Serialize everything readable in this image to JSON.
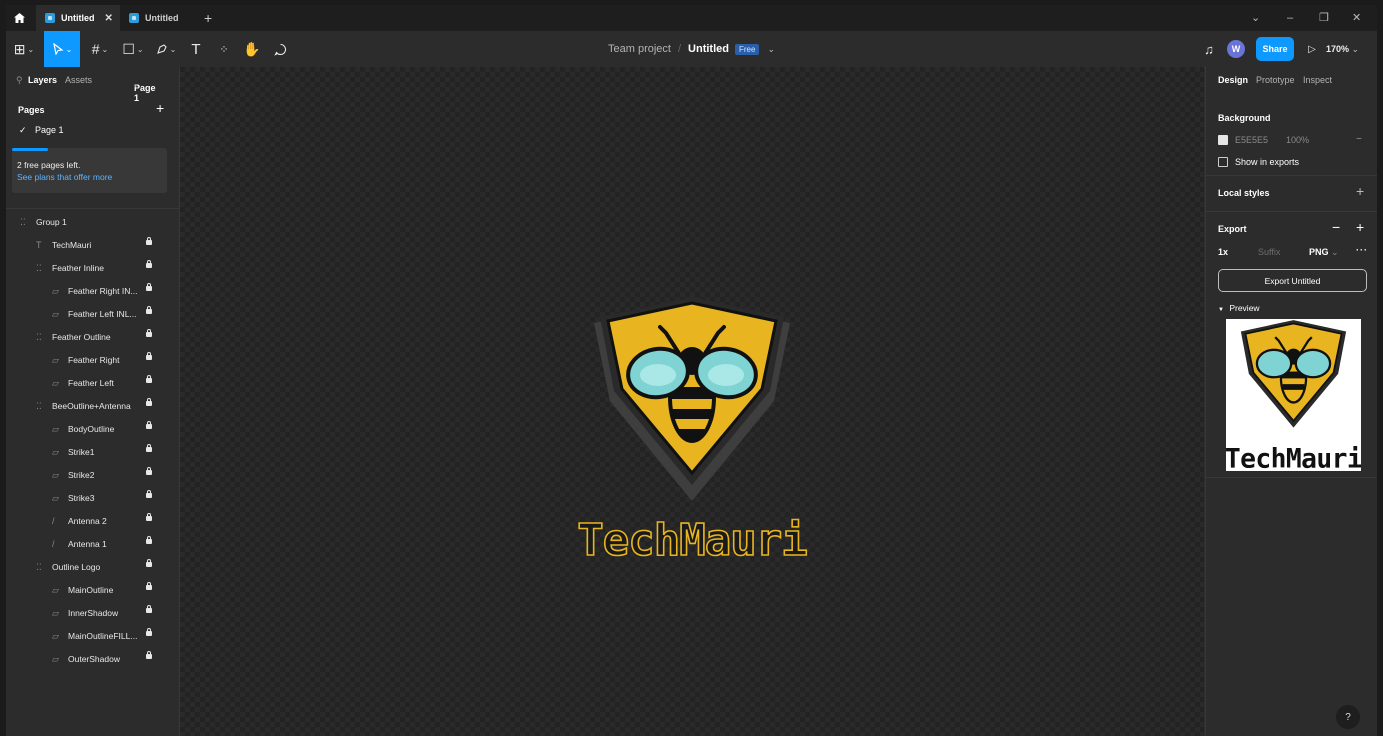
{
  "tabbar": {
    "tabs": [
      {
        "label": "Untitled",
        "active": true
      },
      {
        "label": "Untitled",
        "active": false
      }
    ],
    "new_tab": "+"
  },
  "toolbar": {
    "team": "Team project",
    "separator": "/",
    "file_name": "Untitled",
    "plan_badge": "Free",
    "avatar_initial": "W",
    "share_label": "Share",
    "zoom": "170%"
  },
  "left_panel": {
    "tabs": [
      "Layers",
      "Assets"
    ],
    "page_selector": "Page 1",
    "pages_title": "Pages",
    "pages": [
      "Page 1"
    ],
    "promo_line1": "2 free pages left.",
    "promo_line2": "See plans that offer more",
    "layers": [
      {
        "name": "Group 1",
        "indent": 0,
        "icon": "frame-icon",
        "locked": false
      },
      {
        "name": "TechMauri",
        "indent": 1,
        "icon": "text-icon",
        "locked": true
      },
      {
        "name": "Feather Inline",
        "indent": 1,
        "icon": "frame-icon",
        "locked": true
      },
      {
        "name": "Feather Right IN...",
        "indent": 2,
        "icon": "vector-icon",
        "locked": true
      },
      {
        "name": "Feather Left INL...",
        "indent": 2,
        "icon": "vector-icon",
        "locked": true
      },
      {
        "name": "Feather Outline",
        "indent": 1,
        "icon": "frame-icon",
        "locked": true
      },
      {
        "name": "Feather Right",
        "indent": 2,
        "icon": "vector-icon",
        "locked": true
      },
      {
        "name": "Feather Left",
        "indent": 2,
        "icon": "vector-icon",
        "locked": true
      },
      {
        "name": "BeeOutline+Antenna",
        "indent": 1,
        "icon": "frame-icon",
        "locked": true
      },
      {
        "name": "BodyOutline",
        "indent": 2,
        "icon": "vector-icon",
        "locked": true
      },
      {
        "name": "Strike1",
        "indent": 2,
        "icon": "vector-icon",
        "locked": true
      },
      {
        "name": "Strike2",
        "indent": 2,
        "icon": "vector-icon",
        "locked": true
      },
      {
        "name": "Strike3",
        "indent": 2,
        "icon": "vector-icon",
        "locked": true
      },
      {
        "name": "Antenna 2",
        "indent": 2,
        "icon": "line-icon",
        "locked": true
      },
      {
        "name": "Antenna 1",
        "indent": 2,
        "icon": "line-icon",
        "locked": true
      },
      {
        "name": "Outline Logo",
        "indent": 1,
        "icon": "frame-icon",
        "locked": true
      },
      {
        "name": "MainOutline",
        "indent": 2,
        "icon": "vector-icon",
        "locked": true
      },
      {
        "name": "InnerShadow",
        "indent": 2,
        "icon": "vector-icon",
        "locked": true
      },
      {
        "name": "MainOutlineFILL...",
        "indent": 2,
        "icon": "vector-icon",
        "locked": true
      },
      {
        "name": "OuterShadow",
        "indent": 2,
        "icon": "vector-icon",
        "locked": true
      }
    ]
  },
  "canvas": {
    "logo_text": "TechMauri"
  },
  "right_panel": {
    "tabs": [
      "Design",
      "Prototype",
      "Inspect"
    ],
    "background_title": "Background",
    "bg_hex": "E5E5E5",
    "bg_opacity": "100%",
    "show_in_exports": "Show in exports",
    "local_styles": "Local styles",
    "export_title": "Export",
    "export_scale": "1x",
    "export_suffix_placeholder": "Suffix",
    "export_format": "PNG",
    "export_button": "Export Untitled",
    "preview_label": "Preview",
    "preview_logo_text": "TechMauri"
  },
  "help": "?",
  "colors": {
    "accent": "#0d99ff",
    "logo_yellow": "#e8b520",
    "wing": "#7fd3d3"
  }
}
